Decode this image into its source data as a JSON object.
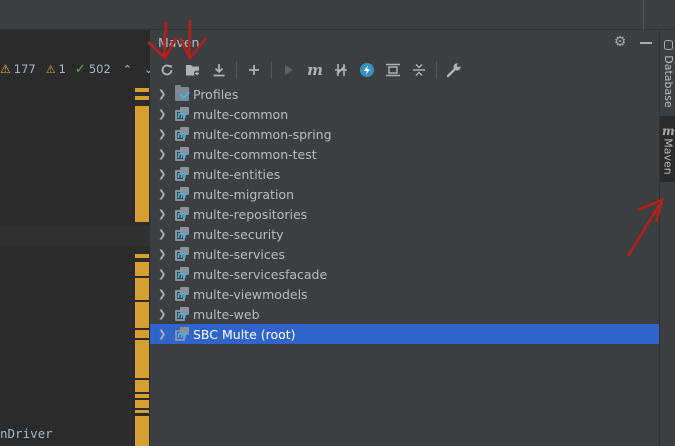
{
  "inspections": {
    "warnings": "177",
    "weak_warnings": "1",
    "ok": "502"
  },
  "editor": {
    "code_fragment": "nDriver"
  },
  "maven": {
    "title": "Maven",
    "tree": [
      {
        "label": "Profiles",
        "kind": "folder",
        "selected": false
      },
      {
        "label": "multe-common",
        "kind": "module",
        "selected": false
      },
      {
        "label": "multe-common-spring",
        "kind": "module",
        "selected": false
      },
      {
        "label": "multe-common-test",
        "kind": "module",
        "selected": false
      },
      {
        "label": "multe-entities",
        "kind": "module",
        "selected": false
      },
      {
        "label": "multe-migration",
        "kind": "module",
        "selected": false
      },
      {
        "label": "multe-repositories",
        "kind": "module",
        "selected": false
      },
      {
        "label": "multe-security",
        "kind": "module",
        "selected": false
      },
      {
        "label": "multe-services",
        "kind": "module",
        "selected": false
      },
      {
        "label": "multe-servicesfacade",
        "kind": "module",
        "selected": false
      },
      {
        "label": "multe-viewmodels",
        "kind": "module",
        "selected": false
      },
      {
        "label": "multe-web",
        "kind": "module",
        "selected": false
      },
      {
        "label": "SBC Multe (root)",
        "kind": "module",
        "selected": true
      }
    ],
    "toolbar_icons": [
      "reload-all-icon",
      "generate-sources-icon",
      "download-icon",
      "add-icon",
      "run-icon",
      "execute-goal-icon",
      "toggle-offline-icon",
      "skip-tests-icon",
      "show-dependencies-icon",
      "collapse-all-icon",
      "settings-wrench-icon"
    ]
  },
  "right_tabs": {
    "database": "Database",
    "maven": "Maven"
  },
  "colors": {
    "selection": "#2f65ca",
    "panel": "#3c3f41",
    "editor": "#2b2b2b",
    "warning_stripe": "#d5a02f",
    "annotation": "#c0201e"
  }
}
